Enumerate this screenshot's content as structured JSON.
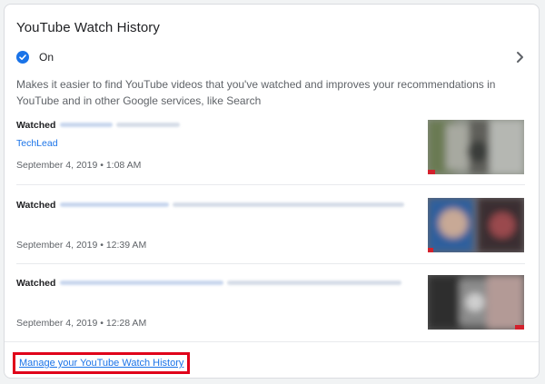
{
  "card": {
    "title": "YouTube Watch History",
    "status_label": "On",
    "description": "Makes it easier to find YouTube videos that you've watched and improves your recommendations in YouTube and in other Google services, like Search",
    "manage_link": "Manage your YouTube Watch History"
  },
  "history": [
    {
      "prefix": "Watched",
      "channel": "TechLead",
      "date": "September 4, 2019 • 1:08 AM"
    },
    {
      "prefix": "Watched",
      "channel": "",
      "date": "September 4, 2019 • 12:39 AM"
    },
    {
      "prefix": "Watched",
      "channel": "",
      "date": "September 4, 2019 • 12:28 AM"
    }
  ],
  "colors": {
    "accent": "#1a73e8",
    "highlight_box": "#e0001a"
  },
  "icons": [
    "check-circle-icon",
    "chevron-right-icon"
  ]
}
